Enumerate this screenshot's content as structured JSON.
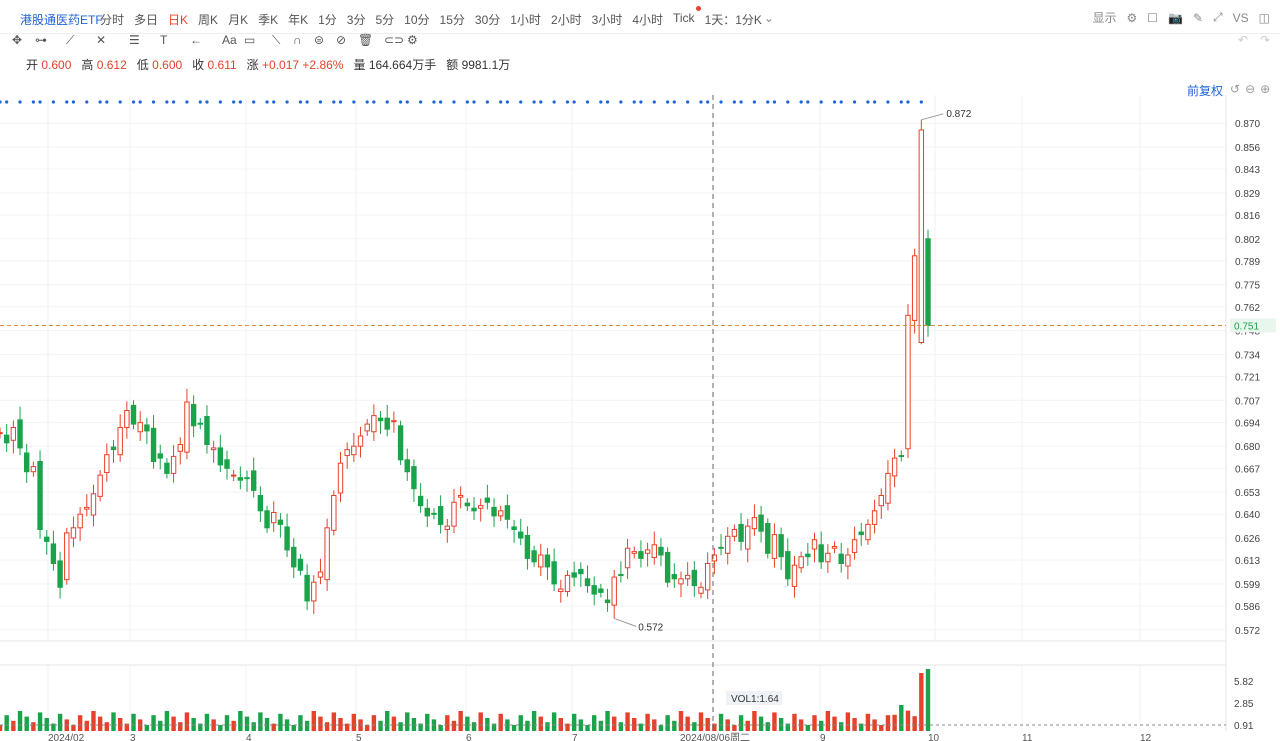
{
  "toolbar": {
    "symbol": "港股通医药ETF",
    "periods": [
      "分时",
      "多日",
      "日K",
      "周K",
      "月K",
      "季K",
      "年K",
      "1分",
      "3分",
      "5分",
      "10分",
      "15分",
      "30分",
      "1小时",
      "2小时",
      "3小时",
      "4小时",
      "Tick",
      "1天：1分K"
    ],
    "active_period": "日K",
    "right_tools": [
      "显示",
      "gear-icon",
      "square-icon",
      "camera-icon",
      "pen-icon",
      "expand-icon",
      "VS",
      "split-icon"
    ],
    "show_label": "显示",
    "vs_label": "VS"
  },
  "quote": {
    "open_label": "开",
    "open": "0.600",
    "high_label": "高",
    "high": "0.612",
    "low_label": "低",
    "low": "0.600",
    "close_label": "收",
    "close": "0.611",
    "change_label": "涨",
    "change": "+0.017",
    "change_pct": "+2.86%",
    "volume_label": "量",
    "volume": "164.664万手",
    "amount_label": "额",
    "amount": "9981.1万"
  },
  "adjust_label": "前复权",
  "colors": {
    "up": "#e6422b",
    "down": "#1aa34a",
    "accent": "#1f63d8",
    "price_line": "#e08a3c",
    "dots": "#1f63d8"
  },
  "chart_data": {
    "type": "candlestick",
    "y_ticks": [
      "0.870",
      "0.856",
      "0.843",
      "0.829",
      "0.816",
      "0.802",
      "0.789",
      "0.775",
      "0.762",
      "0.748",
      "0.734",
      "0.721",
      "0.707",
      "0.694",
      "0.680",
      "0.667",
      "0.653",
      "0.640",
      "0.626",
      "0.613",
      "0.599",
      "0.586",
      "0.572"
    ],
    "ylim": [
      0.566,
      0.876
    ],
    "current_price": "0.751",
    "high_marker": "0.872",
    "low_marker": "0.572",
    "x_labels": [
      "2024/02",
      "3",
      "4",
      "5",
      "6",
      "7",
      "2024/08/06周二",
      "9",
      "10",
      "11",
      "12"
    ],
    "crosshair_x_label": "2024/08/06周二",
    "volume_ticks": [
      "5.82",
      "2.85",
      "0.91"
    ],
    "volume_label": "VOL1:1.64",
    "closes": [
      0.688,
      0.682,
      0.691,
      0.679,
      0.665,
      0.668,
      0.631,
      0.624,
      0.611,
      0.597,
      0.629,
      0.632,
      0.64,
      0.644,
      0.652,
      0.663,
      0.675,
      0.678,
      0.691,
      0.701,
      0.693,
      0.694,
      0.689,
      0.671,
      0.673,
      0.664,
      0.674,
      0.681,
      0.706,
      0.692,
      0.693,
      0.681,
      0.679,
      0.669,
      0.667,
      0.663,
      0.66,
      0.661,
      0.654,
      0.642,
      0.632,
      0.641,
      0.634,
      0.619,
      0.609,
      0.607,
      0.589,
      0.6,
      0.606,
      0.632,
      0.651,
      0.67,
      0.678,
      0.68,
      0.686,
      0.693,
      0.698,
      0.695,
      0.69,
      0.695,
      0.672,
      0.665,
      0.655,
      0.645,
      0.639,
      0.64,
      0.634,
      0.633,
      0.647,
      0.651,
      0.645,
      0.642,
      0.645,
      0.647,
      0.639,
      0.642,
      0.637,
      0.631,
      0.626,
      0.614,
      0.612,
      0.616,
      0.609,
      0.599,
      0.596,
      0.604,
      0.603,
      0.605,
      0.598,
      0.593,
      0.594,
      0.588,
      0.603,
      0.604,
      0.62,
      0.618,
      0.614,
      0.619,
      0.622,
      0.616,
      0.6,
      0.602,
      0.602,
      0.604,
      0.598,
      0.597,
      0.611,
      0.616,
      0.62,
      0.627,
      0.631,
      0.624,
      0.633,
      0.638,
      0.63,
      0.617,
      0.628,
      0.615,
      0.602,
      0.61,
      0.615,
      0.615,
      0.625,
      0.612,
      0.617,
      0.621,
      0.611,
      0.616,
      0.625,
      0.628,
      0.634,
      0.642,
      0.651,
      0.664,
      0.673,
      0.674,
      0.757,
      0.792,
      0.866,
      0.751
    ]
  }
}
